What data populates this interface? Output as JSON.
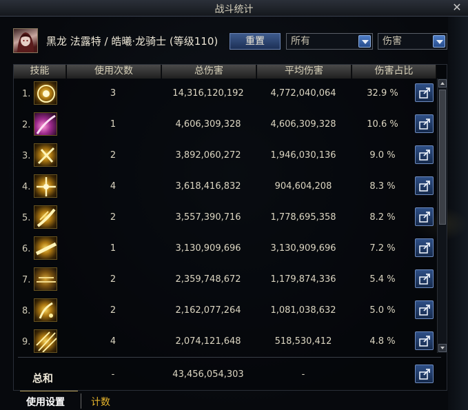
{
  "window": {
    "title": "战斗统计"
  },
  "character": {
    "name_line": "黑龙 法露特 / 皓曦·龙骑士 (等级110)"
  },
  "controls": {
    "reset_label": "重置",
    "filter_value": "所有",
    "metric_value": "伤害"
  },
  "table": {
    "headers": [
      "技能",
      "使用次数",
      "总伤害",
      "平均伤害",
      "伤害占比"
    ],
    "rows": [
      {
        "rank": "1.",
        "uses": "3",
        "total": "14,316,120,192",
        "avg": "4,772,040,064",
        "pct": "32.9 %"
      },
      {
        "rank": "2.",
        "uses": "1",
        "total": "4,606,309,328",
        "avg": "4,606,309,328",
        "pct": "10.6 %"
      },
      {
        "rank": "3.",
        "uses": "2",
        "total": "3,892,060,272",
        "avg": "1,946,030,136",
        "pct": "9.0 %"
      },
      {
        "rank": "4.",
        "uses": "4",
        "total": "3,618,416,832",
        "avg": "904,604,208",
        "pct": "8.3 %"
      },
      {
        "rank": "5.",
        "uses": "2",
        "total": "3,557,390,716",
        "avg": "1,778,695,358",
        "pct": "8.2 %"
      },
      {
        "rank": "6.",
        "uses": "1",
        "total": "3,130,909,696",
        "avg": "3,130,909,696",
        "pct": "7.2 %"
      },
      {
        "rank": "7.",
        "uses": "2",
        "total": "2,359,748,672",
        "avg": "1,179,874,336",
        "pct": "5.4 %"
      },
      {
        "rank": "8.",
        "uses": "2",
        "total": "2,162,077,264",
        "avg": "1,081,038,632",
        "pct": "5.0 %"
      },
      {
        "rank": "9.",
        "uses": "4",
        "total": "2,074,121,648",
        "avg": "518,530,412",
        "pct": "4.8 %"
      }
    ],
    "total_row": {
      "label": "总和",
      "uses": "-",
      "total": "43,456,054,303",
      "avg": "-"
    }
  },
  "tabs": {
    "settings_label": "使用设置",
    "count_label": "计数"
  },
  "colors": {
    "accent_gold": "#e7b52c",
    "button_blue": "#2e4f86",
    "panel_bg": "#07090d"
  }
}
